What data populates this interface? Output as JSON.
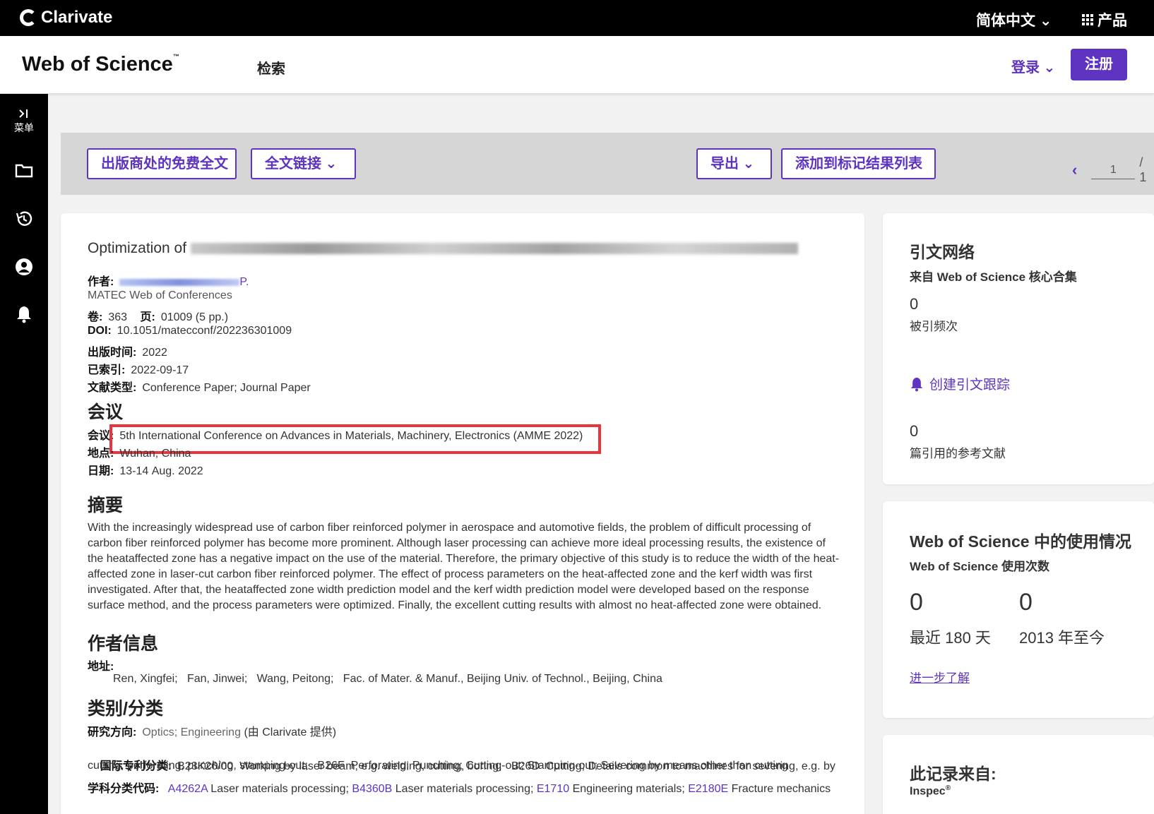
{
  "topbar": {
    "brand": "Clarivate",
    "language": "简体中文 ⌄",
    "products": "产品"
  },
  "header": {
    "logo": "Web of Science",
    "logo_tm": "™",
    "nav_search": "检索",
    "login": "登录 ⌄",
    "register": "注册"
  },
  "sidebar": {
    "menu_label": "菜单"
  },
  "toolbar": {
    "free_full_text": "出版商处的免费全文",
    "full_text_links": "全文链接 ⌄",
    "export": "导出 ⌄",
    "add_to_marked_list": "添加到标记结果列表",
    "page_current": "1",
    "page_total": "/ 1"
  },
  "record": {
    "title_visible": "Optimization of",
    "authors_label": "作者:",
    "authors_tail": "P.",
    "source": "MATEC Web of Conferences",
    "volume_label": "卷:",
    "volume": "363",
    "pages_label": "页:",
    "pages": "01009 (5 pp.)",
    "doi_label": "DOI:",
    "doi": "10.1051/matecconf/202236301009",
    "published_label": "出版时间:",
    "published": "2022",
    "indexed_label": "已索引:",
    "indexed": "2022-09-17",
    "doctype_label": "文献类型:",
    "doctype": "Conference Paper; Journal Paper",
    "conference_heading": "会议",
    "conference_label": "会议:",
    "conference": "5th International Conference on Advances in Materials, Machinery, Electronics (AMME 2022)",
    "location_label": "地点:",
    "location": "Wuhan, China",
    "date_label": "日期:",
    "date": "13-14 Aug. 2022",
    "abstract_heading": "摘要",
    "abstract": "With the increasingly widespread use of carbon fiber reinforced polymer in aerospace and automotive fields, the problem of difficult processing of carbon fiber reinforced polymer has become more prominent. Although laser processing can achieve more ideal processing results, the existence of the heataffected zone has a negative impact on the use of the material. Therefore, the primary objective of this study is to reduce the width of the heat-affected zone in laser-cut carbon fiber reinforced polymer. The effect of process parameters on the heat-affected zone and the kerf width was first investigated. After that, the heataffected zone width prediction model and the kerf width prediction model were developed based on the response surface method, and the process parameters were optimized. Finally, the excellent cutting results with almost no heat-affected zone were obtained.",
    "author_info_heading": "作者信息",
    "address_label": "地址:",
    "address": "Ren, Xingfei;   Fan, Jinwei;   Wang, Peitong;   Fac. of Mater. & Manuf., Beijing Univ. of Technol., Beijing, China",
    "categories_heading": "类别/分类",
    "research_area_label": "研究方向:",
    "research_area": "Optics; Engineering",
    "research_area_note": "(由 Clarivate 提供)",
    "ipc_label": "国际专利分类:",
    "ipc_line1": "B23K26/00  Working by laser beam, e.g. welding, cutting, boring;   B26D  Cutting; Details common to machines for severing, e.g. by",
    "ipc_line2": "cutting, perforating, punching, stamping-out;   B26F  Perforating; Punching; Cutting-out; Stamping-out; Severing by means other than cutting",
    "class_label": "学科分类代码:",
    "class_codes": [
      {
        "code": "A4262A",
        "text": " Laser materials processing; "
      },
      {
        "code": "B4360B",
        "text": " Laser materials processing; "
      },
      {
        "code": "E1710",
        "text": " Engineering materials; "
      },
      {
        "code": "E2180E",
        "text": " Fracture mechanics"
      }
    ]
  },
  "citation_network": {
    "title": "引文网络",
    "subtitle": "来自 Web of Science 核心合集",
    "times_cited": "0",
    "times_cited_label": "被引频次",
    "create_alert": "创建引文跟踪",
    "references": "0",
    "references_label": "篇引用的参考文献"
  },
  "usage": {
    "title": "Web of Science 中的使用情况",
    "subtitle": "Web of Science 使用次数",
    "last180": "0",
    "last180_label": "最近 180 天",
    "since2013": "0",
    "since2013_label": "2013 年至今",
    "learn_more": "进一步了解"
  },
  "record_from": {
    "title": "此记录来自:",
    "source": "Inspec",
    "source_reg": "®"
  },
  "colors": {
    "accent": "#5e33bf",
    "highlight": "#e8343a"
  }
}
